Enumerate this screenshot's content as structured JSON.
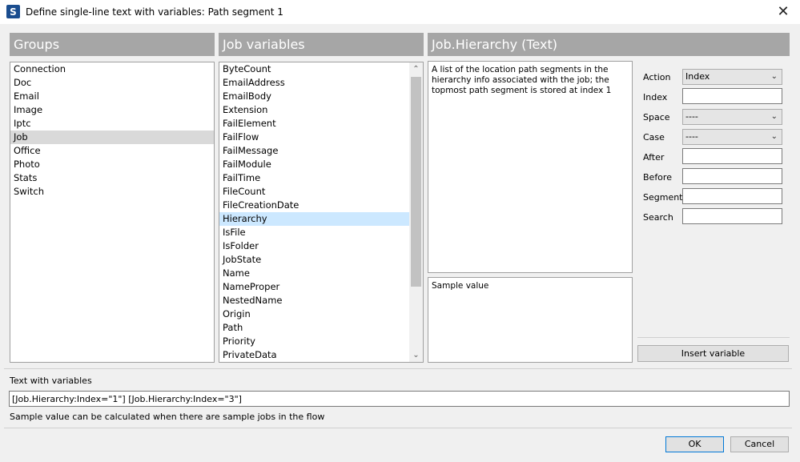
{
  "window": {
    "app_icon_letter": "S",
    "title": "Define single-line text with variables: Path segment 1",
    "close_glyph": "✕"
  },
  "groups": {
    "header": "Groups",
    "items": [
      "Connection",
      "Doc",
      "Email",
      "Image",
      "Iptc",
      "Job",
      "Office",
      "Photo",
      "Stats",
      "Switch"
    ],
    "selected_index": 5
  },
  "job_variables": {
    "header": "Job variables",
    "items": [
      "ByteCount",
      "EmailAddress",
      "EmailBody",
      "Extension",
      "FailElement",
      "FailFlow",
      "FailMessage",
      "FailModule",
      "FailTime",
      "FileCount",
      "FileCreationDate",
      "Hierarchy",
      "IsFile",
      "IsFolder",
      "JobState",
      "Name",
      "NameProper",
      "NestedName",
      "Origin",
      "Path",
      "Priority",
      "PrivateData"
    ],
    "selected_index": 11,
    "scroll_up_glyph": "⌃",
    "scroll_down_glyph": "⌄"
  },
  "detail": {
    "header": "Job.Hierarchy (Text)",
    "description": "A list of the location path segments in the hierarchy info associated with the job; the topmost path segment is stored at index 1",
    "sample_label": "Sample value"
  },
  "options": {
    "action_label": "Action",
    "action_value": "Index",
    "index_label": "Index",
    "index_value": "",
    "space_label": "Space",
    "space_value": "----",
    "case_label": "Case",
    "case_value": "----",
    "after_label": "After",
    "after_value": "",
    "before_label": "Before",
    "before_value": "",
    "segment_label": "Segment",
    "segment_value": "",
    "search_label": "Search",
    "search_value": "",
    "combo_arrow": "⌄"
  },
  "insert_button": "Insert variable",
  "text_with_variables": {
    "label": "Text with variables",
    "value": "[Job.Hierarchy:Index=\"1\"] [Job.Hierarchy:Index=\"3\"]",
    "note": "Sample value can be calculated when there are sample jobs in the flow"
  },
  "buttons": {
    "ok": "OK",
    "cancel": "Cancel"
  }
}
